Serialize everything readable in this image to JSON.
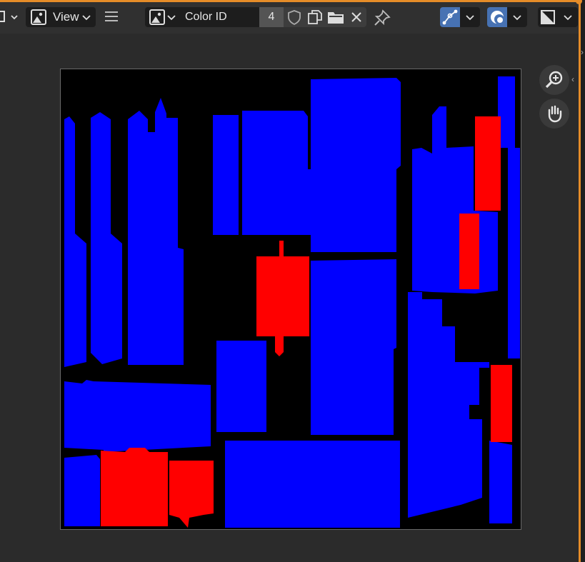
{
  "header": {
    "view_label": "View",
    "image_name": "Color ID",
    "image_users": "4"
  },
  "icons": {
    "mode": "uv-editor-mode-icon",
    "view_image": "image-icon",
    "menu": "hamburger-menu-icon",
    "browse_image": "image-browse-icon",
    "fake_user": "shield-icon",
    "new_image": "duplicate-icon",
    "open_image": "folder-icon",
    "unlink": "close-icon",
    "pin": "pin-icon",
    "uv_sync": "uv-vertex-icon",
    "overlays": "overlay-icon",
    "gizmo": "image-display-icon",
    "zoom": "zoom-in-icon",
    "pan": "hand-icon"
  },
  "colors": {
    "accent_border": "#e58c28",
    "active_button": "#4772b3",
    "id_blue": "#0000ff",
    "id_red": "#ff0000",
    "canvas_bg": "#000000"
  }
}
